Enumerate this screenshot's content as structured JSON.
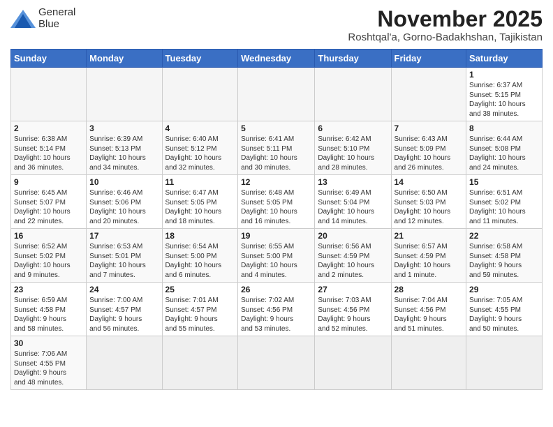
{
  "header": {
    "logo_line1": "General",
    "logo_line2": "Blue",
    "month_year": "November 2025",
    "location": "Roshtqal'a, Gorno-Badakhshan, Tajikistan"
  },
  "weekdays": [
    "Sunday",
    "Monday",
    "Tuesday",
    "Wednesday",
    "Thursday",
    "Friday",
    "Saturday"
  ],
  "weeks": [
    [
      {
        "day": "",
        "info": ""
      },
      {
        "day": "",
        "info": ""
      },
      {
        "day": "",
        "info": ""
      },
      {
        "day": "",
        "info": ""
      },
      {
        "day": "",
        "info": ""
      },
      {
        "day": "",
        "info": ""
      },
      {
        "day": "1",
        "info": "Sunrise: 6:37 AM\nSunset: 5:15 PM\nDaylight: 10 hours\nand 38 minutes."
      }
    ],
    [
      {
        "day": "2",
        "info": "Sunrise: 6:38 AM\nSunset: 5:14 PM\nDaylight: 10 hours\nand 36 minutes."
      },
      {
        "day": "3",
        "info": "Sunrise: 6:39 AM\nSunset: 5:13 PM\nDaylight: 10 hours\nand 34 minutes."
      },
      {
        "day": "4",
        "info": "Sunrise: 6:40 AM\nSunset: 5:12 PM\nDaylight: 10 hours\nand 32 minutes."
      },
      {
        "day": "5",
        "info": "Sunrise: 6:41 AM\nSunset: 5:11 PM\nDaylight: 10 hours\nand 30 minutes."
      },
      {
        "day": "6",
        "info": "Sunrise: 6:42 AM\nSunset: 5:10 PM\nDaylight: 10 hours\nand 28 minutes."
      },
      {
        "day": "7",
        "info": "Sunrise: 6:43 AM\nSunset: 5:09 PM\nDaylight: 10 hours\nand 26 minutes."
      },
      {
        "day": "8",
        "info": "Sunrise: 6:44 AM\nSunset: 5:08 PM\nDaylight: 10 hours\nand 24 minutes."
      }
    ],
    [
      {
        "day": "9",
        "info": "Sunrise: 6:45 AM\nSunset: 5:07 PM\nDaylight: 10 hours\nand 22 minutes."
      },
      {
        "day": "10",
        "info": "Sunrise: 6:46 AM\nSunset: 5:06 PM\nDaylight: 10 hours\nand 20 minutes."
      },
      {
        "day": "11",
        "info": "Sunrise: 6:47 AM\nSunset: 5:05 PM\nDaylight: 10 hours\nand 18 minutes."
      },
      {
        "day": "12",
        "info": "Sunrise: 6:48 AM\nSunset: 5:05 PM\nDaylight: 10 hours\nand 16 minutes."
      },
      {
        "day": "13",
        "info": "Sunrise: 6:49 AM\nSunset: 5:04 PM\nDaylight: 10 hours\nand 14 minutes."
      },
      {
        "day": "14",
        "info": "Sunrise: 6:50 AM\nSunset: 5:03 PM\nDaylight: 10 hours\nand 12 minutes."
      },
      {
        "day": "15",
        "info": "Sunrise: 6:51 AM\nSunset: 5:02 PM\nDaylight: 10 hours\nand 11 minutes."
      }
    ],
    [
      {
        "day": "16",
        "info": "Sunrise: 6:52 AM\nSunset: 5:02 PM\nDaylight: 10 hours\nand 9 minutes."
      },
      {
        "day": "17",
        "info": "Sunrise: 6:53 AM\nSunset: 5:01 PM\nDaylight: 10 hours\nand 7 minutes."
      },
      {
        "day": "18",
        "info": "Sunrise: 6:54 AM\nSunset: 5:00 PM\nDaylight: 10 hours\nand 6 minutes."
      },
      {
        "day": "19",
        "info": "Sunrise: 6:55 AM\nSunset: 5:00 PM\nDaylight: 10 hours\nand 4 minutes."
      },
      {
        "day": "20",
        "info": "Sunrise: 6:56 AM\nSunset: 4:59 PM\nDaylight: 10 hours\nand 2 minutes."
      },
      {
        "day": "21",
        "info": "Sunrise: 6:57 AM\nSunset: 4:59 PM\nDaylight: 10 hours\nand 1 minute."
      },
      {
        "day": "22",
        "info": "Sunrise: 6:58 AM\nSunset: 4:58 PM\nDaylight: 9 hours\nand 59 minutes."
      }
    ],
    [
      {
        "day": "23",
        "info": "Sunrise: 6:59 AM\nSunset: 4:58 PM\nDaylight: 9 hours\nand 58 minutes."
      },
      {
        "day": "24",
        "info": "Sunrise: 7:00 AM\nSunset: 4:57 PM\nDaylight: 9 hours\nand 56 minutes."
      },
      {
        "day": "25",
        "info": "Sunrise: 7:01 AM\nSunset: 4:57 PM\nDaylight: 9 hours\nand 55 minutes."
      },
      {
        "day": "26",
        "info": "Sunrise: 7:02 AM\nSunset: 4:56 PM\nDaylight: 9 hours\nand 53 minutes."
      },
      {
        "day": "27",
        "info": "Sunrise: 7:03 AM\nSunset: 4:56 PM\nDaylight: 9 hours\nand 52 minutes."
      },
      {
        "day": "28",
        "info": "Sunrise: 7:04 AM\nSunset: 4:56 PM\nDaylight: 9 hours\nand 51 minutes."
      },
      {
        "day": "29",
        "info": "Sunrise: 7:05 AM\nSunset: 4:55 PM\nDaylight: 9 hours\nand 50 minutes."
      }
    ],
    [
      {
        "day": "30",
        "info": "Sunrise: 7:06 AM\nSunset: 4:55 PM\nDaylight: 9 hours\nand 48 minutes."
      },
      {
        "day": "",
        "info": ""
      },
      {
        "day": "",
        "info": ""
      },
      {
        "day": "",
        "info": ""
      },
      {
        "day": "",
        "info": ""
      },
      {
        "day": "",
        "info": ""
      },
      {
        "day": "",
        "info": ""
      }
    ]
  ]
}
